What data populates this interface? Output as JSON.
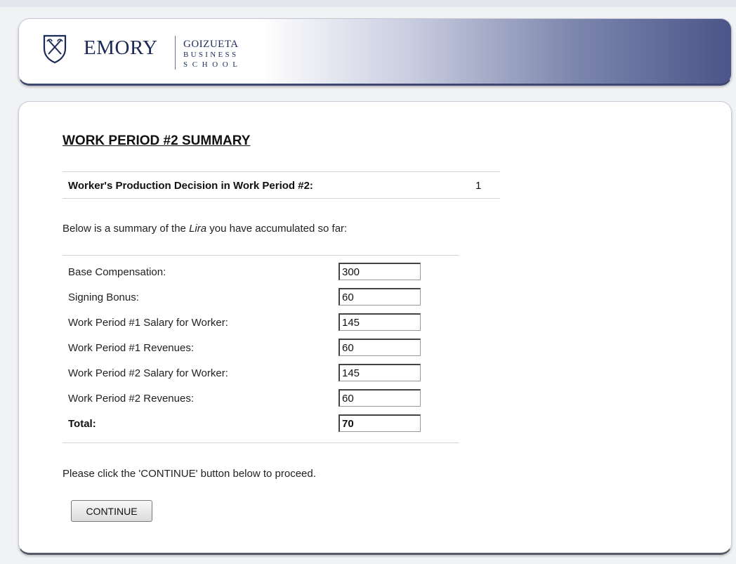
{
  "header": {
    "logo_emory": "EMORY",
    "logo_goizueta": "GOIZUETA",
    "logo_business": "BUSINESS",
    "logo_school": "SCHOOL",
    "shield_icon": "emory-shield-icon"
  },
  "main": {
    "title": "WORK PERIOD #2 SUMMARY",
    "decision": {
      "label": "Worker's Production Decision in Work Period #2:",
      "value": "1"
    },
    "intro": {
      "before": "Below is a summary of the ",
      "emphasis": "Lira",
      "after": " you have accumulated so far:"
    },
    "summary_rows": [
      {
        "label": "Base Compensation:",
        "value": "300"
      },
      {
        "label": "Signing Bonus:",
        "value": "60"
      },
      {
        "label": "Work Period #1 Salary for Worker:",
        "value": "145"
      },
      {
        "label": "Work Period #1 Revenues:",
        "value": "60"
      },
      {
        "label": "Work Period #2 Salary for Worker:",
        "value": "145"
      },
      {
        "label": "Work Period #2 Revenues:",
        "value": "60"
      }
    ],
    "total": {
      "label": "Total:",
      "value": "70"
    },
    "instruction": "Please click the 'CONTINUE' button below to proceed.",
    "continue_label": "CONTINUE"
  },
  "colors": {
    "brand_navy": "#1c2a57",
    "header_gradient_end": "#4b5589"
  }
}
